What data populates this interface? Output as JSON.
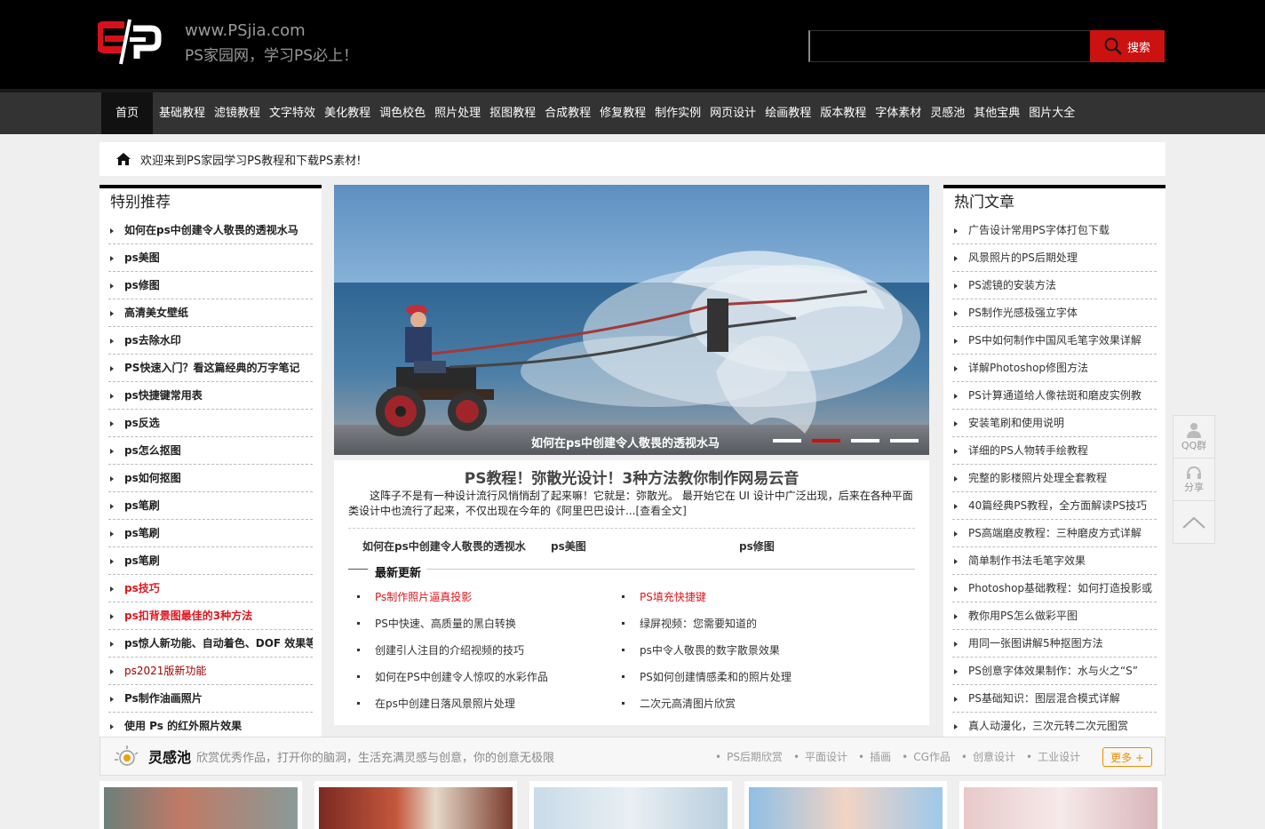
{
  "header": {
    "site_url": "www.PSjia.com",
    "slogan": "PS家园网，学习PS必上！",
    "search_placeholder": "",
    "search_label": "搜索"
  },
  "nav": [
    "首页",
    "基础教程",
    "滤镜教程",
    "文字特效",
    "美化教程",
    "调色校色",
    "照片处理",
    "抠图教程",
    "合成教程",
    "修复教程",
    "制作实例",
    "网页设计",
    "绘画教程",
    "版本教程",
    "字体素材",
    "灵感池",
    "其他宝典",
    "图片大全"
  ],
  "welcome": "欢迎来到PS家园学习PS教程和下载PS素材!",
  "left": {
    "title": "特别推荐",
    "items": [
      "如何在ps中创建令人敬畏的透视水马",
      "ps美图",
      "ps修图",
      "高清美女壁纸",
      "ps去除水印",
      "PS快速入门？看这篇经典的万字笔记",
      "ps快捷键常用表",
      "ps反选",
      "ps怎么抠图",
      "ps如何抠图",
      "ps笔刷",
      "ps笔刷",
      "ps笔刷",
      "ps技巧",
      "ps扣背景图最佳的3种方法",
      "ps惊人新功能、自动着色、DOF 效果等",
      "ps2021版新功能",
      "Ps制作油画照片",
      "使用 Ps 的红外照片效果"
    ]
  },
  "slider": {
    "caption": "如何在ps中创建令人敬畏的透视水马",
    "active_dot": 2,
    "dot_count": 4
  },
  "article": {
    "headline": "PS教程！弥散光设计！3种方法教你制作网易云音",
    "summary": "这阵子不是有一种设计流行风悄悄刮了起来嘛！它就是：弥散光。 最开始它在 UI 设计中广泛出现，后来在各种平面类设计中也流行了起来，不仅出现在今年的《阿里巴巴设计...",
    "read_more": "[查看全文]",
    "quick_links": [
      "如何在ps中创建令人敬畏的透视水",
      "ps美图",
      "ps修图"
    ]
  },
  "latest": {
    "title": "最新更新",
    "col1": [
      "Ps制作照片逼真投影",
      "PS中快速、高质量的黑白转换",
      "创建引人注目的介绍视频的技巧",
      "如何在PS中创建令人惊叹的水彩作品",
      "在ps中创建日落风景照片处理"
    ],
    "col2": [
      "PS填充快捷键",
      "绿屏视频：您需要知道的",
      "ps中令人敬畏的数字散景效果",
      "PS如何创建情感柔和的照片处理",
      "二次元高清图片欣赏"
    ]
  },
  "right": {
    "title": "热门文章",
    "items": [
      "广告设计常用PS字体打包下载",
      "风景照片的PS后期处理",
      "PS滤镜的安装方法",
      "PS制作光感极强立字体",
      "PS中如何制作中国风毛笔字效果详解",
      "详解Photoshop修图方法",
      "PS计算通道给人像祛斑和磨皮实例教",
      "安装笔刷和使用说明",
      "详细的PS人物转手绘教程",
      "完整的影楼照片处理全套教程",
      "40篇经典PS教程，全方面解读PS技巧",
      "PS高端磨皮教程：三种磨皮方式详解",
      "简单制作书法毛笔字效果",
      "Photoshop基础教程：如何打造投影或",
      "教你用PS怎么做彩平图",
      "用同一张图讲解5种抠图方法",
      "PS创意字体效果制作：水与火之“S”",
      "PS基础知识：图层混合模式详解",
      "真人动漫化，三次元转二次元图赏"
    ]
  },
  "floatbar": {
    "qq": "QQ群",
    "share": "分享"
  },
  "inspire": {
    "title": "灵感池",
    "desc": "欣赏优秀作品，打开你的脑洞，生活充满灵感与创意，你的创意无极限",
    "tags": [
      "PS后期欣赏",
      "平面设计",
      "插画",
      "CG作品",
      "创意设计",
      "工业设计"
    ],
    "more": "更多 +"
  },
  "colors": {
    "brand_red": "#cc1111",
    "link_red": "#e0161e",
    "orange": "#f08a00"
  }
}
